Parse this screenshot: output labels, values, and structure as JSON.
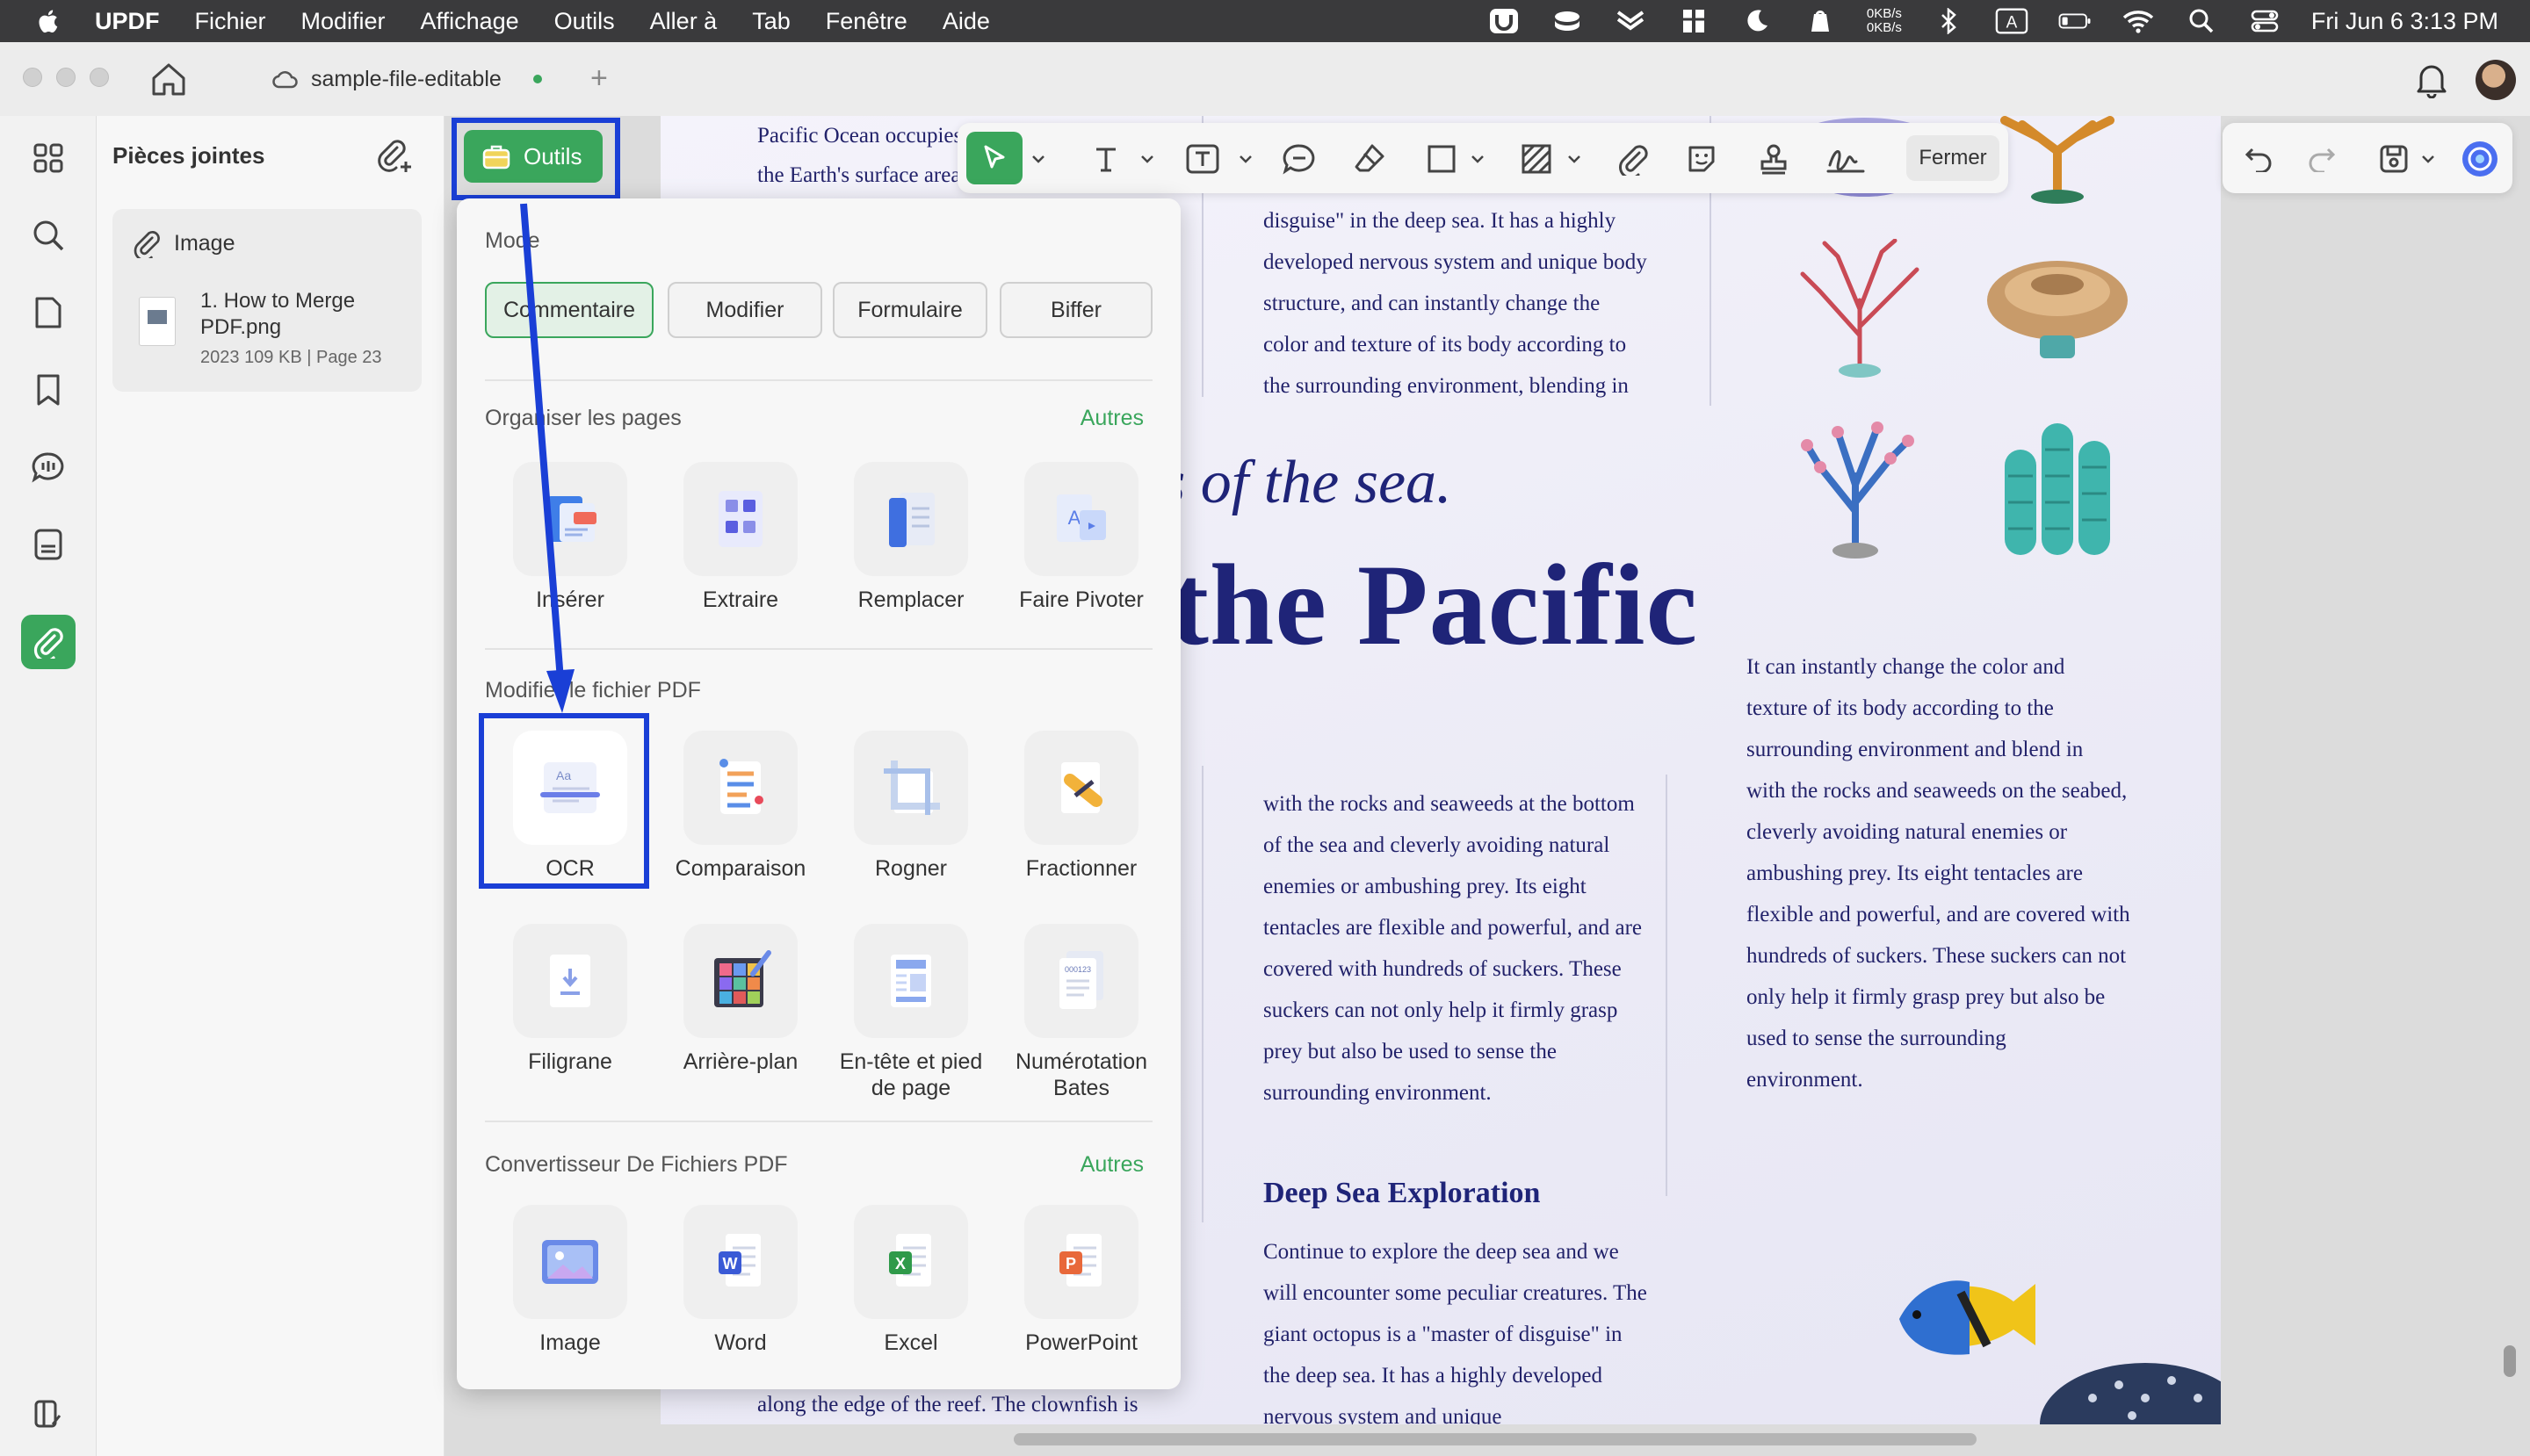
{
  "menubar": {
    "app_name": "UPDF",
    "items": [
      "Fichier",
      "Modifier",
      "Affichage",
      "Outils",
      "Aller à",
      "Tab",
      "Fenêtre",
      "Aide"
    ],
    "net_up": "0KB/s",
    "net_down": "0KB/s",
    "input_badge": "A",
    "datetime": "Fri Jun 6  3:13 PM"
  },
  "window": {
    "tab_title": "sample-file-editable"
  },
  "attachments": {
    "title": "Pièces jointes",
    "card_title": "Image",
    "file_name": "1. How to Merge PDF.png",
    "file_year": "2023",
    "file_size": "109 KB",
    "file_page": "Page 23"
  },
  "toolbar": {
    "outils_label": "Outils",
    "close_label": "Fermer"
  },
  "popup": {
    "mode_title": "Mode",
    "modes": [
      "Commentaire",
      "Modifier",
      "Formulaire",
      "Biffer"
    ],
    "active_mode": "Commentaire",
    "organize_title": "Organiser les pages",
    "organize_link": "Autres",
    "organize_tools": [
      "Insérer",
      "Extraire",
      "Remplacer",
      "Faire Pivoter"
    ],
    "modify_title": "Modifier le fichier PDF",
    "modify_tools_row1": [
      "OCR",
      "Comparaison",
      "Rogner",
      "Fractionner"
    ],
    "modify_tools_row2": [
      "Filigrane",
      "Arrière-plan",
      "En-tête et pied de page",
      "Numérotation Bates"
    ],
    "convert_title": "Convertisseur De Fichiers PDF",
    "convert_link": "Autres",
    "convert_tools": [
      "Image",
      "Word",
      "Excel",
      "PowerPoint"
    ]
  },
  "document": {
    "col_left_top": [
      "Pacific Ocean occupies",
      "the Earth's surface area"
    ],
    "col_mid_top": [
      "disguise\" in the deep sea. It has a highly",
      "developed nervous system and unique body",
      "structure, and can instantly change the",
      "color and texture of its body according to",
      "the surrounding environment, blending in"
    ],
    "heading_italic": "s of the sea.",
    "heading_big": "the Pacific",
    "col_mid_bottom": [
      "with the rocks and seaweeds at the bottom",
      "of the sea and cleverly avoiding natural",
      "enemies or ambushing prey. Its eight",
      "tentacles are flexible and powerful, and are",
      "covered with hundreds of suckers. These",
      "suckers can not only help it firmly grasp",
      "prey but also be used to sense the",
      "surrounding environment."
    ],
    "col_right": [
      "It can instantly change the color and",
      "texture of its body according to the",
      "surrounding environment and blend in",
      "with the rocks and seaweeds on the seabed,",
      "cleverly avoiding natural enemies or",
      "ambushing prey. Its eight tentacles are",
      "flexible and powerful, and are covered with",
      "hundreds of suckers. These suckers can not",
      "only help it firmly grasp prey but also be",
      "used to sense the surrounding",
      "environment."
    ],
    "section_heading": "Deep Sea Exploration",
    "col_section": [
      "Continue to explore the deep sea and we",
      "will encounter some peculiar creatures. The",
      "giant octopus is a \"master of disguise\" in",
      "the deep sea. It has a highly developed",
      "nervous system and unique"
    ],
    "col_left_bottom": "along the edge of the reef. The clownfish is"
  }
}
